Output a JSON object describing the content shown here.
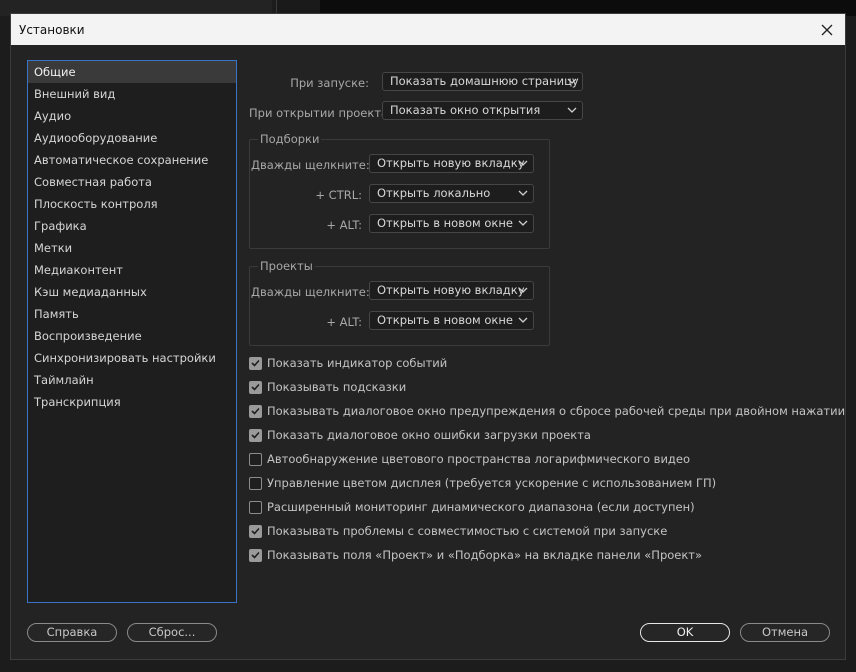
{
  "window": {
    "title": "Установки"
  },
  "sidebar": {
    "selected_index": 0,
    "items": [
      "Общие",
      "Внешний вид",
      "Аудио",
      "Аудиооборудование",
      "Автоматическое сохранение",
      "Совместная работа",
      "Плоскость контроля",
      "Графика",
      "Метки",
      "Медиаконтент",
      "Кэш медиаданных",
      "Память",
      "Воспроизведение",
      "Синхронизировать настройки",
      "Таймлайн",
      "Транскрипция"
    ]
  },
  "general": {
    "startup_label": "При запуске:",
    "startup_value": "Показать домашнюю страницу",
    "open_project_label": "При открытии проекта:",
    "open_project_value": "Показать окно открытия"
  },
  "bins": {
    "title": "Подборки",
    "double_click_label": "Дважды щелкните:",
    "double_click_value": "Открыть новую вкладку",
    "ctrl_label": "+ CTRL:",
    "ctrl_value": "Открыть локально",
    "alt_label": "+ ALT:",
    "alt_value": "Открыть в новом окне"
  },
  "projects": {
    "title": "Проекты",
    "double_click_label": "Дважды щелкните:",
    "double_click_value": "Открыть новую вкладку",
    "alt_label": "+ ALT:",
    "alt_value": "Открыть в новом окне"
  },
  "checkboxes": [
    {
      "label": "Показать индикатор событий",
      "checked": true
    },
    {
      "label": "Показывать подсказки",
      "checked": true
    },
    {
      "label": "Показывать диалоговое окно предупреждения о сбросе рабочей среды при двойном нажатии",
      "checked": true
    },
    {
      "label": "Показать диалоговое окно ошибки загрузки проекта",
      "checked": true
    },
    {
      "label": "Автообнаружение цветового пространства логарифмического видео",
      "checked": false
    },
    {
      "label": "Управление цветом дисплея (требуется ускорение с использованием ГП)",
      "checked": false
    },
    {
      "label": "Расширенный мониторинг динамического диапазона (если доступен)",
      "checked": false
    },
    {
      "label": "Показывать проблемы с совместимостью с системой при запуске",
      "checked": true
    },
    {
      "label": "Показывать поля «Проект» и «Подборка» на вкладке панели «Проект»",
      "checked": true
    }
  ],
  "buttons": {
    "help": "Справка",
    "reset": "Сброс...",
    "ok": "OK",
    "cancel": "Отмена"
  },
  "colors": {
    "accent_border": "#3b74c6",
    "dialog_bg": "#232323",
    "titlebar_bg": "#f3f3f3"
  }
}
